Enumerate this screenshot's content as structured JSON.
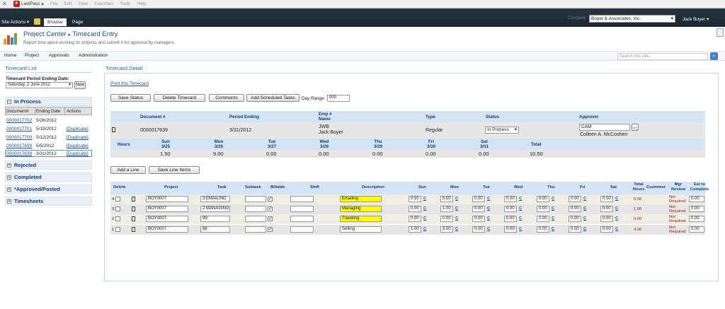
{
  "lastpass": {
    "brand": "LastPass",
    "caret": "▾",
    "menu": [
      "File",
      "Edit",
      "View",
      "Favorites",
      "Tools",
      "Help"
    ]
  },
  "ribbon": {
    "site_actions": "Site Actions",
    "tabs": [
      "Browse",
      "Page"
    ],
    "company_label": "Company",
    "company_value": "Boyer & Associates, Inc.",
    "user": "Jack Boyer"
  },
  "header": {
    "title": "Project Center",
    "subtitle": "Timecard Entry",
    "separator": "▸",
    "description": "Report time spent working on projects and submit it for approval by managers."
  },
  "nav": {
    "items": [
      "Home",
      "Project",
      "Approvals",
      "Administration"
    ],
    "search_placeholder": "Search this site..."
  },
  "sidebar": {
    "title": "Timecard List",
    "period_label": "Timecard Period Ending Date:",
    "period_value": "Saturday, 2 June 2012",
    "new_label": "New",
    "in_process": {
      "label": "In Process",
      "headers": [
        "Document#",
        "Ending Date",
        "Actions"
      ],
      "rows": [
        {
          "doc": "0000017702",
          "date": "5/26/2012",
          "action": ""
        },
        {
          "doc": "0000017701",
          "date": "5/19/2012",
          "action": "[Duplicate]"
        },
        {
          "doc": "0000017700",
          "date": "5/12/2012",
          "action": "[Duplicate]"
        },
        {
          "doc": "0000017699",
          "date": "5/5/2012",
          "action": "[Duplicate]"
        },
        {
          "doc": "0000017639",
          "date": "3/31/2012",
          "action": "[Duplicate]"
        }
      ]
    },
    "groups": [
      "Rejected",
      "Completed",
      "*Approved/Posted",
      "Timesheets"
    ]
  },
  "detail": {
    "title": "Timecard Detail",
    "print": "Print this Timecard",
    "buttons": {
      "save_status": "Save Status",
      "delete": "Delete Timecard",
      "comments": "Comments",
      "add_tasks": "Add Scheduled Tasks"
    },
    "day_range_label": "Day Range:",
    "day_range_value": "000",
    "summary_headers": {
      "doc": "Document #",
      "period": "Period Ending",
      "emp": "Emp # Name",
      "type": "Type",
      "status": "Status",
      "approver": "Approver"
    },
    "summary": {
      "doc": "0000017639",
      "period": "3/31/2012",
      "emp_id": "JWB",
      "emp_name": "Jack Boyer",
      "type": "Regular",
      "status": "In Process",
      "approver_code": "CAM",
      "approver_name": "Colleen A. McCoshen",
      "browse": "..."
    },
    "hours_label": "Hours",
    "days": [
      {
        "day": "Sun",
        "date": "3/25",
        "hours": "1.50"
      },
      {
        "day": "Mon",
        "date": "3/26",
        "hours": "9.00"
      },
      {
        "day": "Tue",
        "date": "3/27",
        "hours": "0.00"
      },
      {
        "day": "Wed",
        "date": "3/28",
        "hours": "0.00"
      },
      {
        "day": "Thu",
        "date": "3/29",
        "hours": "0.00"
      },
      {
        "day": "Fri",
        "date": "3/30",
        "hours": "0.00"
      },
      {
        "day": "Sat",
        "date": "3/31",
        "hours": "0.00"
      }
    ],
    "total_label": "Total",
    "total_hours": "10.50",
    "add_line": "Add a Line",
    "save_lines": "Save Line Items"
  },
  "lines": {
    "headers": [
      "Delete",
      "Project",
      "Task",
      "Subtask",
      "Billable",
      "Shift",
      "Description",
      "Sun",
      "Mon",
      "Tue",
      "Wed",
      "Thu",
      "Fri",
      "Sat",
      "Total Hours",
      "Customer",
      "Mgr Review",
      "Est to Complete"
    ],
    "day_link": "C",
    "rows": [
      {
        "num": "4",
        "project": "BOY0007",
        "task": "3 EMAILING",
        "desc": "Emailing",
        "highlight": true,
        "hours": [
          "0.50",
          "5.00",
          "0.00",
          "0.00",
          "0.00",
          "0.00",
          "0.00"
        ],
        "total": "5.50",
        "review": "Not Required",
        "est": "0.00"
      },
      {
        "num": "3",
        "project": "BOY0007",
        "task": "2 MANAGING",
        "desc": "Managing",
        "highlight": true,
        "hours": [
          "0.00",
          "1.00",
          "0.00",
          "0.00",
          "0.00",
          "0.00",
          "0.00"
        ],
        "total": "1.00",
        "review": "Not Required",
        "est": "0.00"
      },
      {
        "num": "2",
        "project": "BOY0007",
        "task": "99",
        "desc": "Traveling",
        "highlight": true,
        "hours": [
          "0.00",
          "0.00",
          "0.00",
          "0.00",
          "0.00",
          "0.00",
          "0.00"
        ],
        "total": "0.00",
        "review": "Not Required",
        "est": "0.00"
      },
      {
        "num": "1",
        "project": "BOY0007",
        "task": "88",
        "desc": "Selling",
        "highlight": false,
        "hours": [
          "1.00",
          "3.00",
          "0.00",
          "0.00",
          "0.00",
          "0.00",
          "0.00"
        ],
        "total": "4.00",
        "review": "Not Required",
        "est": "0.00"
      }
    ]
  },
  "colors": {
    "accent": "#2266aa",
    "header_band": "#d4e4f4",
    "red": "#a01818",
    "highlight": "#ffff00"
  }
}
